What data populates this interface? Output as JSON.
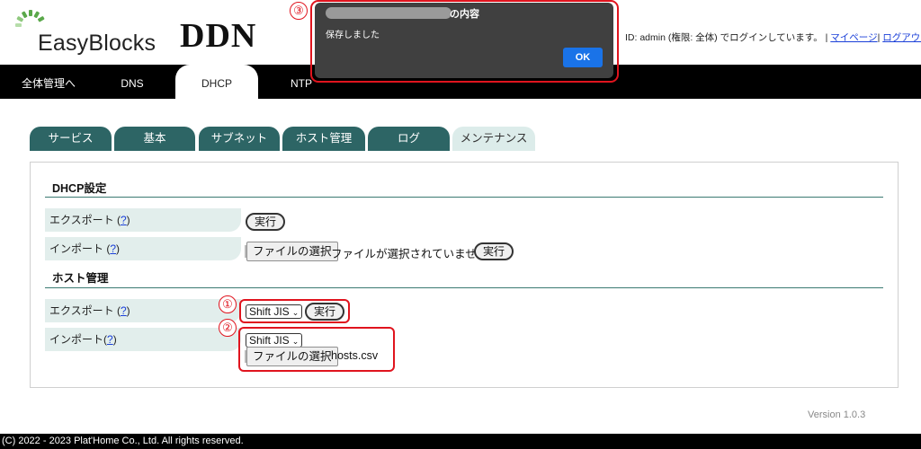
{
  "header": {
    "logo_text": "EasyBlocks",
    "brand": "DDN",
    "login_text": "ID: admin (権限: 全体) でログインしています。 | ",
    "mypage_link": "マイページ",
    "separator": "| ",
    "logout_link": "ログアウト"
  },
  "nav": {
    "tabs": [
      {
        "label": "全体管理へ"
      },
      {
        "label": "DNS"
      },
      {
        "label": "DHCP"
      },
      {
        "label": "NTP"
      }
    ],
    "active": "DHCP"
  },
  "subtabs": {
    "items": [
      {
        "label": "サービス"
      },
      {
        "label": "基本"
      },
      {
        "label": "サブネット"
      },
      {
        "label": "ホスト管理"
      },
      {
        "label": "ログ"
      },
      {
        "label": "メンテナンス"
      }
    ],
    "active": "メンテナンス"
  },
  "dhcp_section": {
    "title": "DHCP設定",
    "export_label": "エクスポート (",
    "export_help": "?",
    "close_paren": ")",
    "import_label": "インポート (",
    "import_help": "?",
    "exec_label": "実行",
    "file_button": "ファイルの選択",
    "no_file_text": "ファイルが選択されていません"
  },
  "host_section": {
    "title": "ホスト管理",
    "export_label": "エクスポート (",
    "export_help": "?",
    "close_paren": ")",
    "import_label": "インポート(",
    "import_help": "?",
    "encoding_select": "Shift JIS",
    "exec_label": "実行",
    "file_button": "ファイルの選択",
    "file_name": "hosts.csv"
  },
  "markers": {
    "one": "①",
    "two": "②",
    "three": "③"
  },
  "dialog": {
    "title_suffix": "の内容",
    "message": "保存しました",
    "ok_label": "OK"
  },
  "version": "Version 1.0.3",
  "footer": "(C) 2022 - 2023 Plat'Home Co., Ltd. All rights reserved.",
  "colors": {
    "accent_teal": "#2d6565",
    "highlight_red": "#e0141e",
    "dialog_bg": "#404040",
    "ok_blue": "#1a73e8"
  }
}
